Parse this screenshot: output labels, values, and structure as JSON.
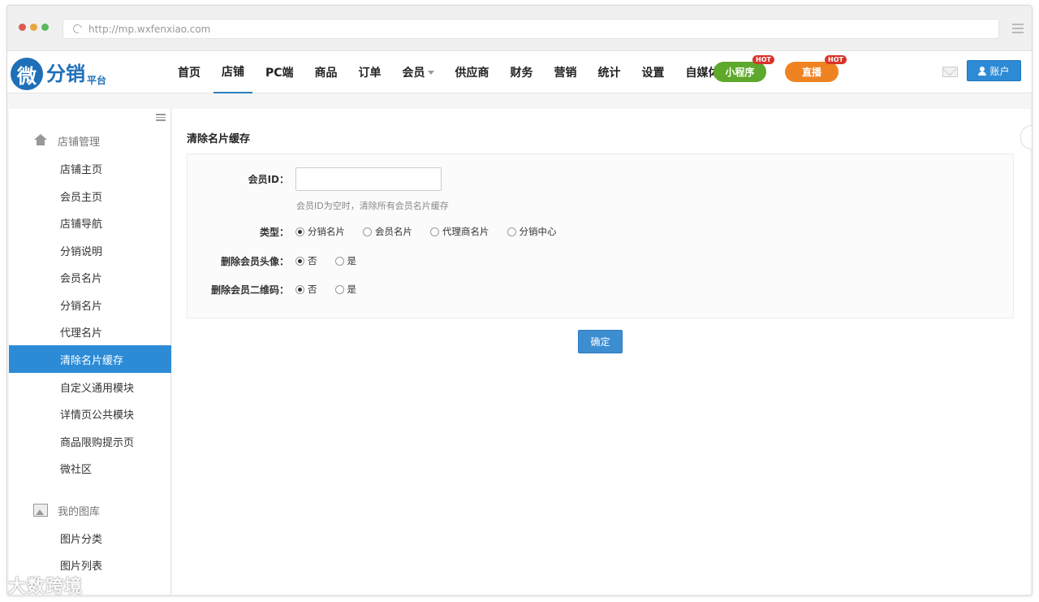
{
  "browser": {
    "url": "http://mp.wxfenxiao.com",
    "dot_colors": [
      "#e05a4f",
      "#e8a640",
      "#5cb85c"
    ]
  },
  "logo": {
    "mark": "微",
    "text": "分销",
    "sub": "平台"
  },
  "nav": {
    "items": [
      {
        "label": "首页"
      },
      {
        "label": "店铺",
        "active": true
      },
      {
        "label": "PC端"
      },
      {
        "label": "商品"
      },
      {
        "label": "订单"
      },
      {
        "label": "会员",
        "has_dropdown": true
      },
      {
        "label": "供应商"
      },
      {
        "label": "财务"
      },
      {
        "label": "营销"
      },
      {
        "label": "统计"
      },
      {
        "label": "设置"
      },
      {
        "label": "自媒体"
      }
    ],
    "pill_miniprogram": "小程序",
    "pill_live": "直播",
    "hot_badge": "HOT",
    "account_button": "账户",
    "colors": {
      "accent": "#2d8bd6",
      "green": "#5ea82b",
      "orange": "#f08321",
      "hot": "#d9342b"
    }
  },
  "sidebar": {
    "group1": "店铺管理",
    "items1": [
      "店铺主页",
      "会员主页",
      "店铺导航",
      "分销说明",
      "会员名片",
      "分销名片",
      "代理名片",
      "清除名片缓存",
      "自定义通用模块",
      "详情页公共模块",
      "商品限购提示页",
      "微社区"
    ],
    "active_item": "清除名片缓存",
    "group2": "我的图库",
    "items2": [
      "图片分类",
      "图片列表"
    ]
  },
  "form": {
    "title": "清除名片缓存",
    "member_id_label": "会员ID：",
    "member_id_value": "",
    "member_id_hint": "会员ID为空时，清除所有会员名片缓存",
    "type_label": "类型：",
    "type_options": [
      "分销名片",
      "会员名片",
      "代理商名片",
      "分销中心"
    ],
    "type_selected": "分销名片",
    "avatar_label": "删除会员头像：",
    "avatar_options": [
      "否",
      "是"
    ],
    "avatar_selected": "否",
    "qrcode_label": "删除会员二维码：",
    "qrcode_options": [
      "否",
      "是"
    ],
    "qrcode_selected": "否",
    "confirm_button": "确定"
  },
  "watermark": "大数跨境"
}
